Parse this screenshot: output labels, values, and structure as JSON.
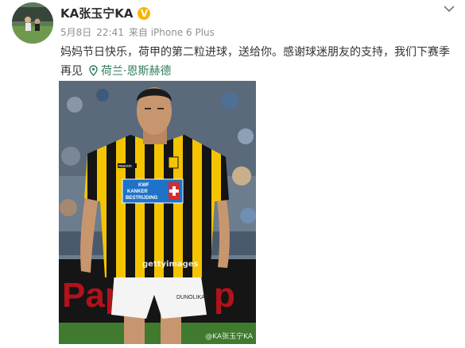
{
  "post": {
    "username": "KA张玉宁KA",
    "verified_badge": "V",
    "date": "5月8日",
    "time": "22:41",
    "source": "来自 iPhone 6 Plus",
    "text": "妈妈节日快乐，荷甲的第二粒进球，送给你。感谢球迷朋友的支持，我们下赛季再见",
    "location": "荷兰·恩斯赫德"
  },
  "photo": {
    "jersey_sponsor_line1": "KWF",
    "jersey_sponsor_line2": "KANKER",
    "jersey_sponsor_line3": "BESTRIJDING",
    "shirt_brand": "macron",
    "shorts_brand": "DUNOLIKAR",
    "getty_mark": "gettyimages",
    "watermark": "@KA张玉宁KA",
    "board_text": "Pap"
  },
  "icons": {
    "more": "chevron-down-icon",
    "location": "location-pin-icon",
    "badge": "verified-badge-icon"
  },
  "colors": {
    "accent_location": "#2f7c5b",
    "badge": "#f7b500",
    "meta": "#8f8f8f",
    "text": "#333333"
  }
}
